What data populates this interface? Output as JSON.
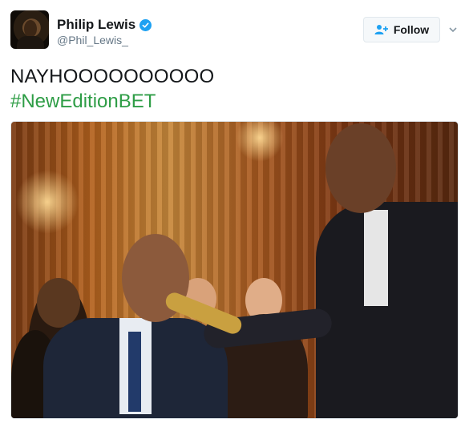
{
  "author": {
    "display_name": "Philip Lewis",
    "handle": "@Phil_Lewis_",
    "verified": true
  },
  "follow_button": {
    "label": "Follow",
    "icon": "add-user-icon"
  },
  "menu_icon": "chevron-down-icon",
  "tweet": {
    "text": "NAYHOOOOOOOOOO",
    "hashtag": "#NewEditionBET"
  },
  "media": {
    "icon": "photo"
  },
  "colors": {
    "verified_blue": "#1da1f2",
    "hashtag_green": "#2e9d46",
    "handle_gray": "#657786"
  }
}
